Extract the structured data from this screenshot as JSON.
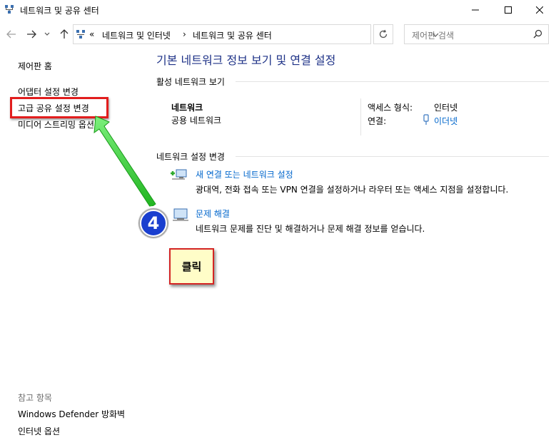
{
  "window": {
    "title": "네트워크 및 공유 센터"
  },
  "navigation": {
    "back_icon": "back-arrow-icon",
    "forward_icon": "forward-arrow-icon",
    "breadcrumb": {
      "overflow": "«",
      "items": [
        "네트워크 및 인터넷",
        "네트워크 및 공유 센터"
      ],
      "separator": "›"
    },
    "search_placeholder": "제어판 검색"
  },
  "sidebar": {
    "items": [
      {
        "label": "제어판 홈"
      },
      {
        "label": "어댑터 설정 변경"
      },
      {
        "label": "고급 공유 설정 변경"
      },
      {
        "label": "미디어 스트리밍 옵션"
      }
    ],
    "see_also_header": "참고 항목",
    "see_also": [
      {
        "label": "Windows Defender 방화벽"
      },
      {
        "label": "인터넷 옵션"
      }
    ]
  },
  "main": {
    "title": "기본 네트워크 정보 보기 및 연결 설정",
    "active_header": "활성 네트워크 보기",
    "network": {
      "name": "네트워크",
      "type": "공용 네트워크",
      "access_label": "액세스 형식:",
      "access_value": "인터넷",
      "connection_label": "연결:",
      "connection_value": "이더넷"
    },
    "change_header": "네트워크 설정 변경",
    "tasks": [
      {
        "link": "새 연결 또는 네트워크 설정",
        "desc": "광대역, 전화 접속 또는 VPN 연결을 설정하거나 라우터 또는 액세스 지점을 설정합니다."
      },
      {
        "link": "문제 해결",
        "desc": "네트워크 문제를 진단 및 해결하거나 문제 해결 정보를 얻습니다."
      }
    ]
  },
  "annotation": {
    "step_number": "4",
    "callout_text": "클릭",
    "colors": {
      "highlight": "#e21d1d",
      "arrow": "#2fd12f",
      "callout_bg": "#fffdc8",
      "badge": "#1a3fcf"
    }
  }
}
